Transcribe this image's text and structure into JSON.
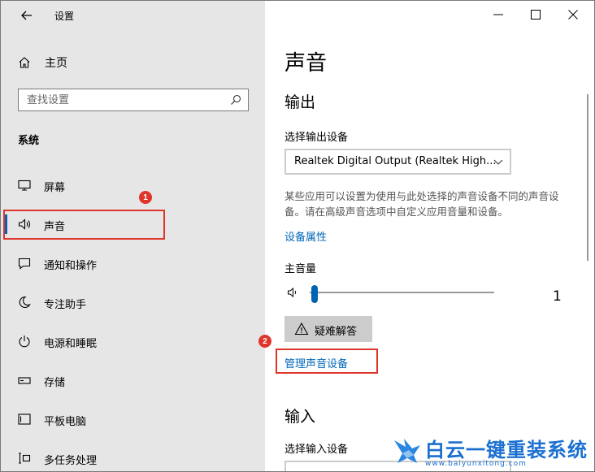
{
  "window": {
    "title": "设置"
  },
  "sidebar": {
    "home_label": "主页",
    "search_placeholder": "查找设置",
    "section_title": "系统",
    "items": [
      {
        "label": "屏幕",
        "icon": "monitor-icon"
      },
      {
        "label": "声音",
        "icon": "speaker-icon",
        "active": true
      },
      {
        "label": "通知和操作",
        "icon": "notification-icon"
      },
      {
        "label": "专注助手",
        "icon": "moon-icon"
      },
      {
        "label": "电源和睡眠",
        "icon": "power-icon"
      },
      {
        "label": "存储",
        "icon": "storage-icon"
      },
      {
        "label": "平板电脑",
        "icon": "tablet-icon"
      },
      {
        "label": "多任务处理",
        "icon": "multitask-icon"
      }
    ]
  },
  "annotations": {
    "badge1": "1",
    "badge2": "2",
    "color": "#e0352b"
  },
  "content": {
    "page_title": "声音",
    "output_heading": "输出",
    "output_device_label": "选择输出设备",
    "output_device_value": "Realtek Digital Output (Realtek High...",
    "description": "某些应用可以设置为使用与此处选择的声音设备不同的声音设备。请在高级声音选项中自定义应用音量和设备。",
    "device_properties_link": "设备属性",
    "master_volume_label": "主音量",
    "volume_value": "1",
    "volume_level": 0.01,
    "troubleshoot_button": "疑难解答",
    "manage_devices_link": "管理声音设备",
    "input_heading": "输入",
    "input_device_label": "选择输入设备"
  },
  "watermark": {
    "title": "白云一键重装系统",
    "url": "www.baiyunxitong.com"
  },
  "colors": {
    "accent": "#0063b1",
    "link": "#0067b8",
    "sidebar_bg": "#e6e6e6"
  }
}
